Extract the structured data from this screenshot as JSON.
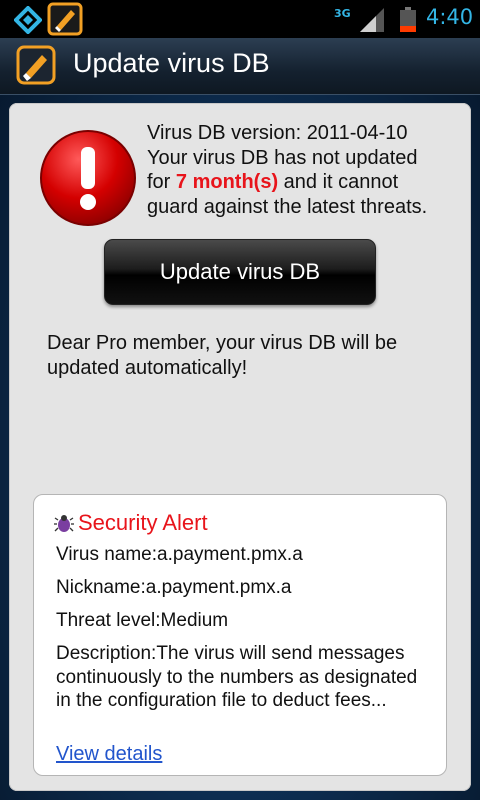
{
  "status_bar": {
    "network_type": "3G",
    "time": "4:40",
    "icons": [
      "diamond-notification-icon",
      "app-notification-icon",
      "signal-icon",
      "battery-icon"
    ]
  },
  "title_bar": {
    "icon": "app-logo-icon",
    "title": "Update virus DB"
  },
  "db_status": {
    "icon": "exclamation-alert-icon",
    "version_line": "Virus DB version: 2011-04-10",
    "line2": "Your virus DB has not updated",
    "for_prefix": "for ",
    "age_highlight": "7 month(s)",
    "for_suffix": " and it cannot",
    "line4": "guard against the latest threats."
  },
  "update_button": {
    "label": "Update virus DB"
  },
  "pro_message": "Dear Pro member, your virus DB will be updated automatically!",
  "security_alert": {
    "icon": "bug-icon",
    "title": "Security Alert",
    "virus_name": "Virus name:a.payment.pmx.a",
    "nickname": "Nickname:a.payment.pmx.a",
    "threat_level": "Threat level:Medium",
    "description": "Description:The virus will send messages continuously to the numbers as designated in the configuration file to deduct fees...",
    "view_details": "View details"
  },
  "colors": {
    "status_accent": "#33b5e5",
    "highlight_red": "#e8141b",
    "link_blue": "#2255cc",
    "panel_bg": "#e4e4e4"
  }
}
